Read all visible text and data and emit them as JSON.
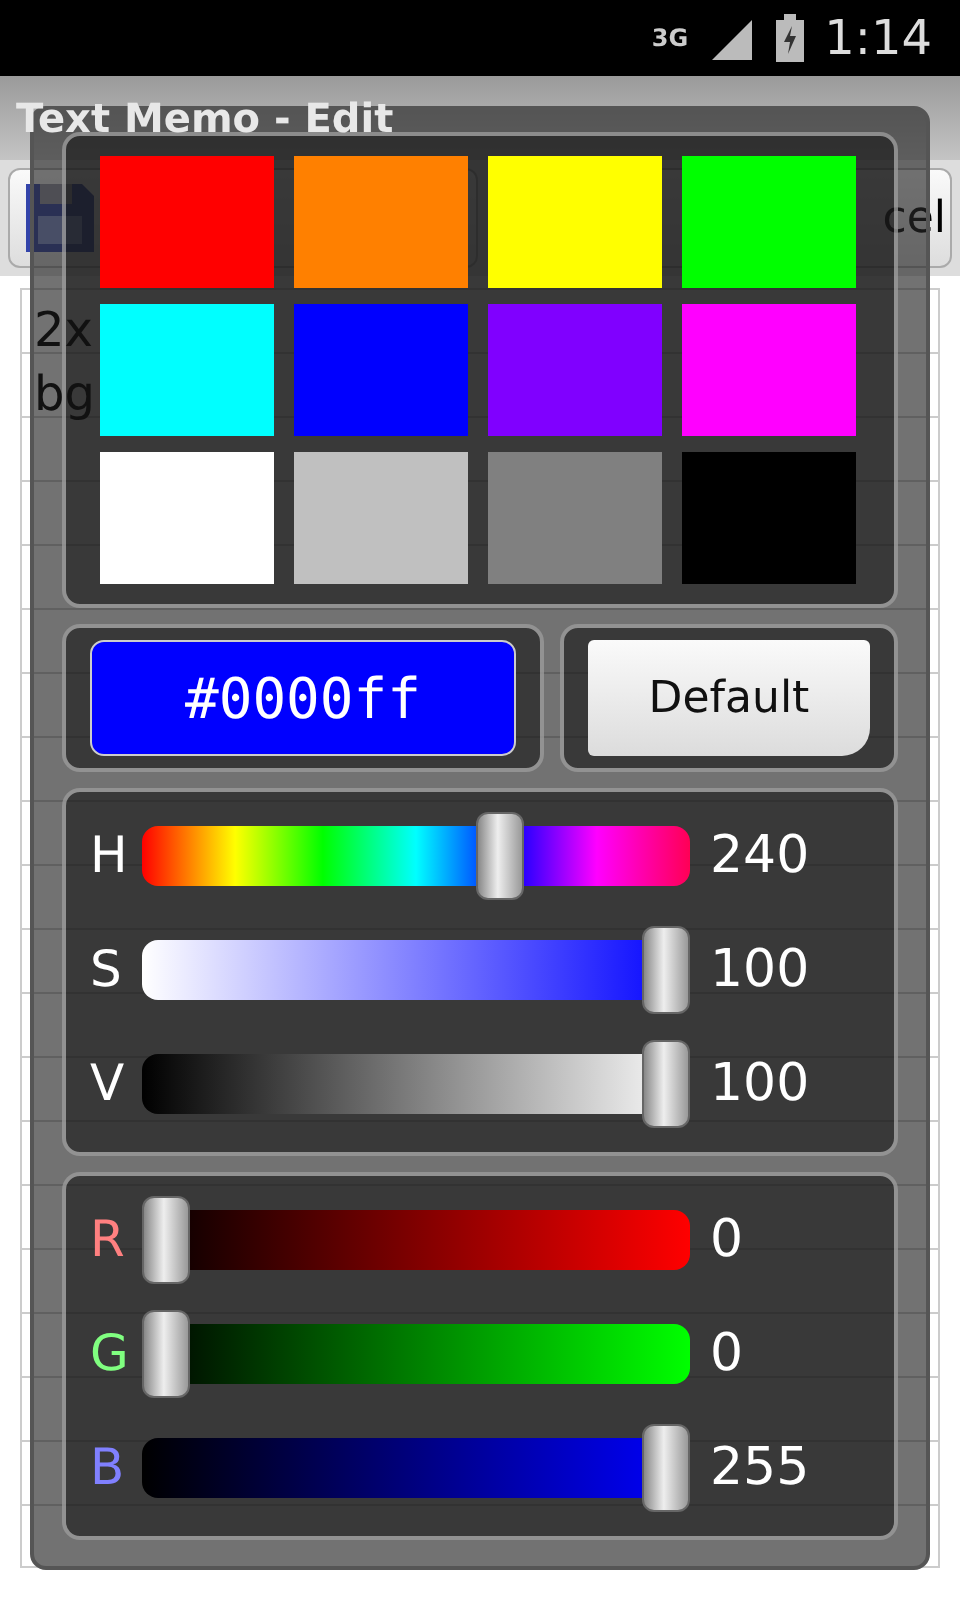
{
  "status_bar": {
    "network": "3G",
    "time": "1:14"
  },
  "app": {
    "title": "Text Memo - Edit",
    "toolbar": [
      {
        "kind": "save"
      },
      {
        "label": "cel",
        "kind": "cancel"
      }
    ],
    "memo_lines": [
      "2x",
      "bg"
    ]
  },
  "picker": {
    "swatches": [
      {
        "color": "#ff0000"
      },
      {
        "color": "#ff8000"
      },
      {
        "color": "#ffff00"
      },
      {
        "color": "#00ff00"
      },
      {
        "color": "#00ffff"
      },
      {
        "color": "#0000ff"
      },
      {
        "color": "#8000ff"
      },
      {
        "color": "#ff00ff"
      },
      {
        "color": "#ffffff"
      },
      {
        "color": "#c0c0c0"
      },
      {
        "color": "#808080"
      },
      {
        "color": "#000000"
      }
    ],
    "hex": "#0000ff",
    "default_button": "Default",
    "hsv": [
      {
        "label": "H",
        "kind": "hue",
        "level": 0.667,
        "reading": "240"
      },
      {
        "label": "S",
        "kind": "saturation",
        "level": 1,
        "reading": "100"
      },
      {
        "label": "V",
        "kind": "value",
        "level": 1,
        "reading": "100"
      }
    ],
    "rgb": [
      {
        "label": "R",
        "kind": "red",
        "color": "#ff8080",
        "level": 0,
        "reading": "0"
      },
      {
        "label": "G",
        "kind": "green",
        "color": "#80ff80",
        "level": 0,
        "reading": "0"
      },
      {
        "label": "B",
        "kind": "blue",
        "color": "#8080ff",
        "level": 1,
        "reading": "255"
      }
    ]
  }
}
